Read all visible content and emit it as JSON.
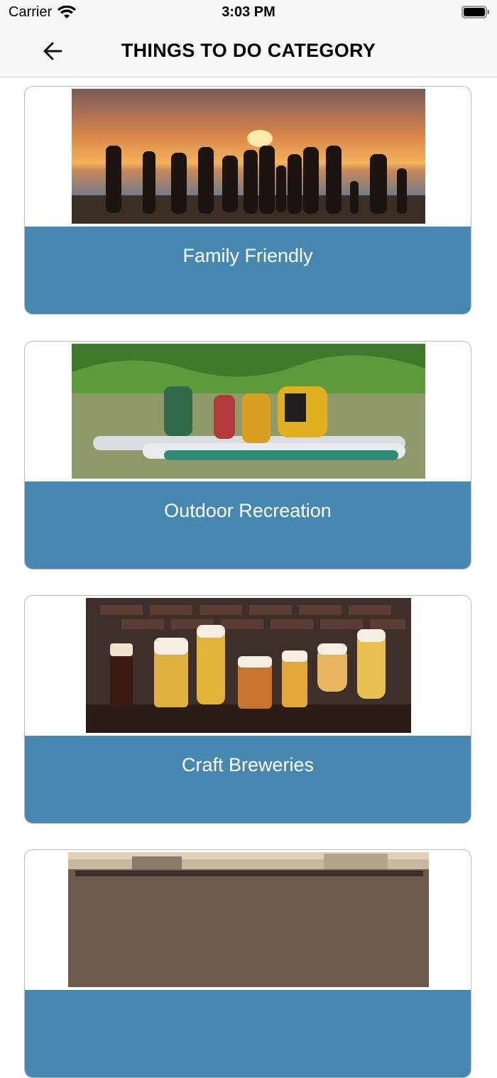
{
  "status": {
    "carrier": "Carrier",
    "time": "3:03 PM"
  },
  "header": {
    "title": "THINGS TO DO CATEGORY",
    "back_icon": "arrow-left-icon"
  },
  "categories": [
    {
      "label": "Family Friendly",
      "image": "family-at-beach-sunset"
    },
    {
      "label": "Outdoor Recreation",
      "image": "paddleboarders-on-lake"
    },
    {
      "label": "Craft Breweries",
      "image": "beer-glasses-on-table"
    },
    {
      "label": "",
      "image": "outdoor-festival-crowd"
    }
  ],
  "colors": {
    "card_label_bg": "#4688b0",
    "bar_bg": "#f7f7f7"
  }
}
